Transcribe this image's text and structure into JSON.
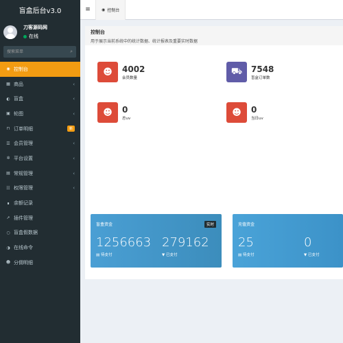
{
  "sidebar": {
    "brand": "盲盒后台v3.0",
    "user": {
      "name": "刀客源码网",
      "status": "在线"
    },
    "search": {
      "placeholder": "搜索菜单"
    },
    "items": [
      {
        "label": "控制台",
        "icon": "dashboard-icon",
        "glyph": "◉"
      },
      {
        "label": "商品",
        "icon": "goods-icon",
        "glyph": "▦",
        "arrow": "‹"
      },
      {
        "label": "盲盒",
        "icon": "box-icon",
        "glyph": "◐",
        "arrow": "‹"
      },
      {
        "label": "轮图",
        "icon": "image-icon",
        "glyph": "▣",
        "arrow": "‹"
      },
      {
        "label": "订单明细",
        "icon": "cart-icon",
        "glyph": "⊓",
        "badge": "新"
      },
      {
        "label": "会员管理",
        "icon": "users-icon",
        "glyph": "☰",
        "arrow": "‹"
      },
      {
        "label": "平台设置",
        "icon": "gear-icon",
        "glyph": "✲",
        "arrow": "‹"
      },
      {
        "label": "常规管理",
        "icon": "cogs-icon",
        "glyph": "▤",
        "arrow": "‹"
      },
      {
        "label": "权限管理",
        "icon": "group-icon",
        "glyph": "☷",
        "arrow": "‹"
      },
      {
        "label": "余额记录",
        "icon": "money-icon",
        "glyph": "∎"
      },
      {
        "label": "插件管理",
        "icon": "rocket-icon",
        "glyph": "➚"
      },
      {
        "label": "盲盒假数据",
        "icon": "circle-icon",
        "glyph": "○"
      },
      {
        "label": "在线命令",
        "icon": "terminal-icon",
        "glyph": "◑"
      },
      {
        "label": "分佣明细",
        "icon": "share-icon",
        "glyph": "☻"
      }
    ]
  },
  "header": {
    "tab_label": "控制台"
  },
  "main": {
    "title": "控制台",
    "subtitle": "用于展示当前系统中的统计数据、统计报表及重要实时数据",
    "stats": [
      {
        "value": "4002",
        "label": "会员数量",
        "icon": "users-icon",
        "color": "#dd4b39"
      },
      {
        "value": "7548",
        "label": "盲盒订单数",
        "icon": "cart-icon",
        "color": "#605ca8"
      },
      {
        "value": "0",
        "label": "总uv",
        "icon": "users-icon",
        "color": "#dd4b39"
      },
      {
        "value": "0",
        "label": "当日uv",
        "icon": "users-icon",
        "color": "#dd4b39"
      }
    ],
    "panels": [
      {
        "title": "盲盒资金",
        "tag": "实时",
        "color": "#3c8dbc",
        "a_value": "1256663",
        "a_label": "待支付",
        "b_value": "279162",
        "b_label": "已支付"
      },
      {
        "title": "充值资金",
        "color": "#3c8dbc",
        "a_value": "25",
        "a_label": "待支付",
        "b_value": "0",
        "b_label": "已支付"
      }
    ]
  }
}
